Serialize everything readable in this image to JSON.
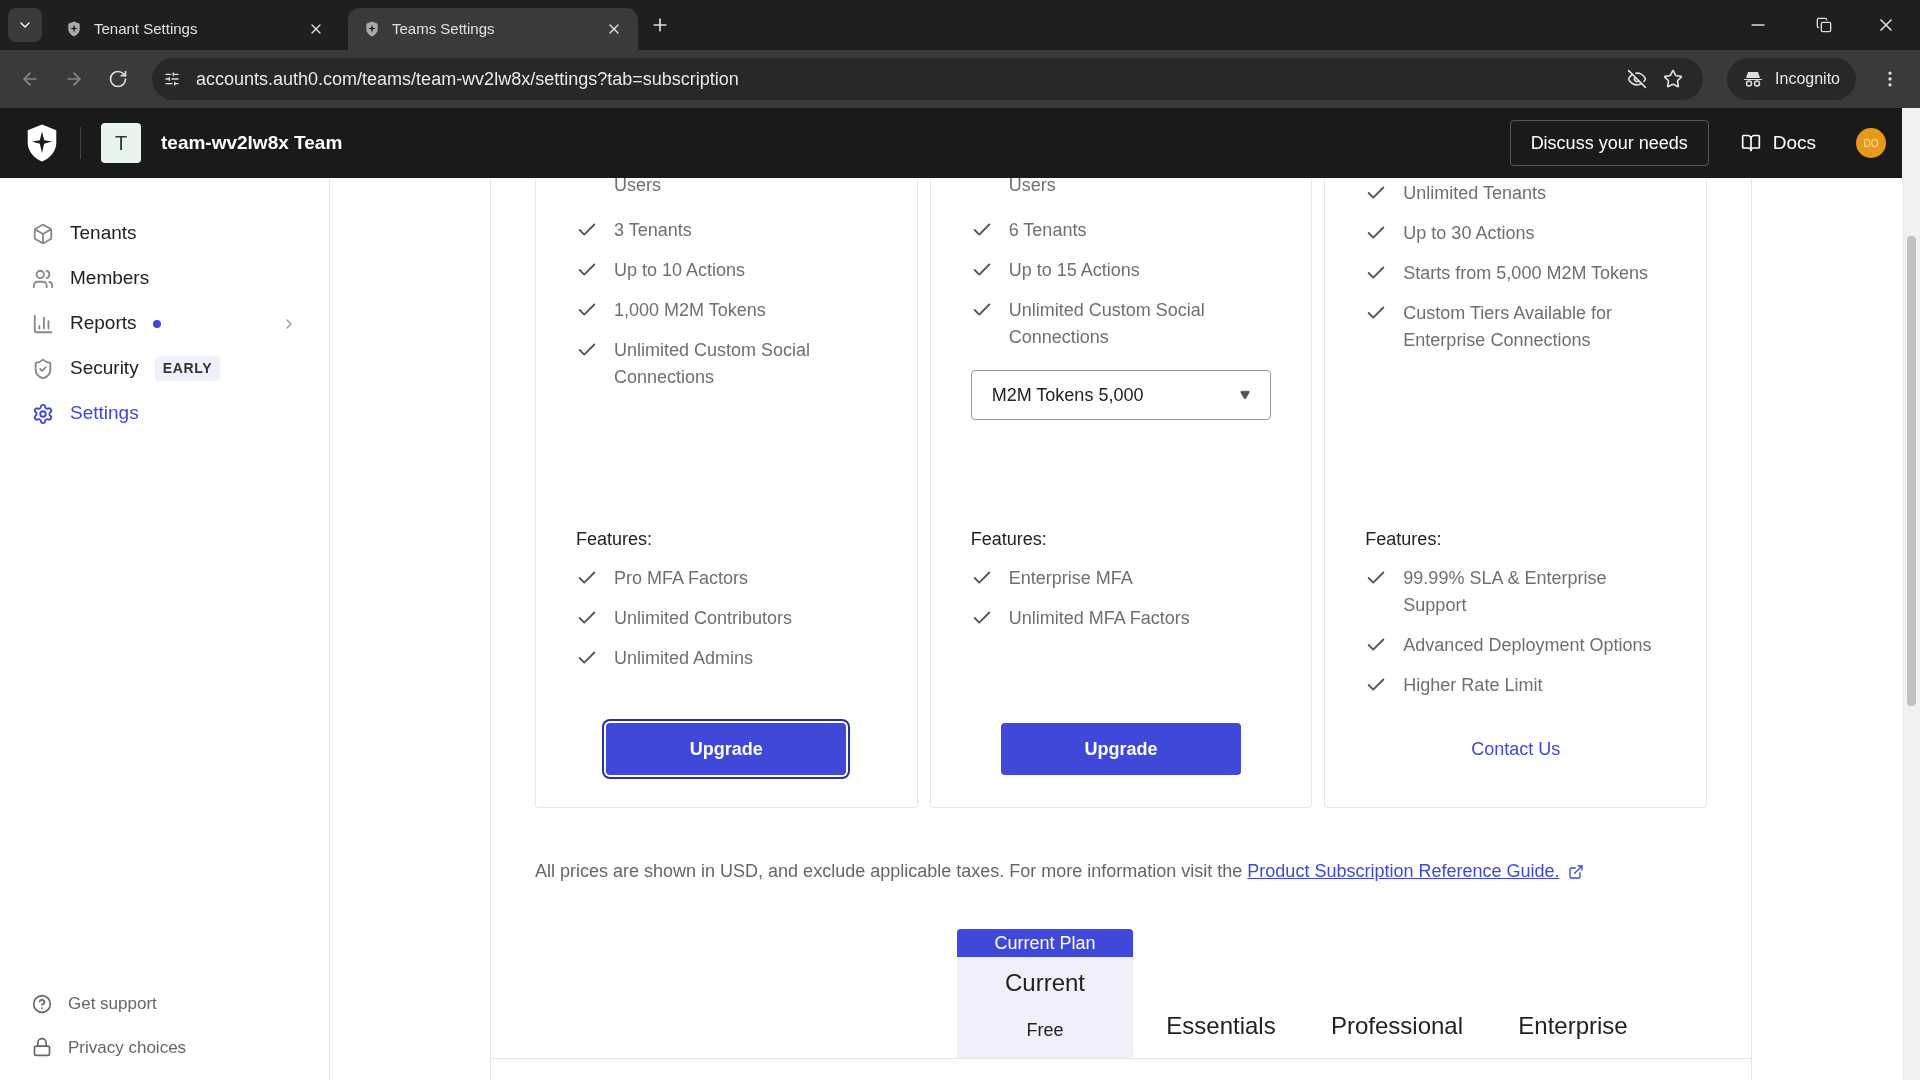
{
  "browser": {
    "tabs": [
      {
        "title": "Tenant Settings",
        "selected": false
      },
      {
        "title": "Teams Settings",
        "selected": true
      }
    ],
    "url": "accounts.auth0.com/teams/team-wv2lw8x/settings?tab=subscription",
    "profile": "Incognito"
  },
  "header": {
    "team_initial": "T",
    "team_name": "team-wv2lw8x Team",
    "discuss_button": "Discuss your needs",
    "docs": "Docs",
    "avatar": "DO"
  },
  "sidebar": {
    "items": [
      {
        "label": "Tenants",
        "selected": false
      },
      {
        "label": "Members",
        "selected": false
      },
      {
        "label": "Reports",
        "selected": false,
        "dot": true,
        "chevron": true
      },
      {
        "label": "Security",
        "selected": false,
        "badge": "EARLY"
      },
      {
        "label": "Settings",
        "selected": true
      }
    ],
    "footer": [
      {
        "label": "Get support"
      },
      {
        "label": "Privacy choices"
      }
    ]
  },
  "plans": [
    {
      "limits": [
        {
          "kind": "continuation",
          "text": "Users"
        },
        {
          "kind": "item",
          "text": "3 Tenants"
        },
        {
          "kind": "item",
          "text": "Up to 10 Actions"
        },
        {
          "kind": "item",
          "text": "1,000 M2M Tokens"
        },
        {
          "kind": "item",
          "text": "Unlimited Custom Social Connections"
        }
      ],
      "features_label": "Features:",
      "features": [
        "Pro MFA Factors",
        "Unlimited Contributors",
        "Unlimited Admins"
      ],
      "action": {
        "kind": "button",
        "label": "Upgrade",
        "focused": true
      }
    },
    {
      "limits": [
        {
          "kind": "continuation",
          "text": "Users"
        },
        {
          "kind": "item",
          "text": "6 Tenants"
        },
        {
          "kind": "item",
          "text": "Up to 15 Actions"
        },
        {
          "kind": "item",
          "text": "Unlimited Custom Social Connections"
        }
      ],
      "select": "M2M Tokens 5,000",
      "features_label": "Features:",
      "features": [
        "Enterprise MFA",
        "Unlimited MFA Factors"
      ],
      "action": {
        "kind": "button",
        "label": "Upgrade",
        "focused": false
      }
    },
    {
      "limits": [
        {
          "kind": "item",
          "text": "Unlimited Tenants"
        },
        {
          "kind": "item",
          "text": "Up to 30 Actions"
        },
        {
          "kind": "item",
          "text": "Starts from 5,000 M2M Tokens"
        },
        {
          "kind": "item",
          "text": "Custom Tiers Available for Enterprise Connections"
        }
      ],
      "features_label": "Features:",
      "features": [
        "99.99% SLA & Enterprise Support",
        "Advanced Deployment Options",
        "Higher Rate Limit"
      ],
      "action": {
        "kind": "link",
        "label": "Contact Us",
        "focused": false
      }
    }
  ],
  "note": {
    "text": "All prices are shown in USD, and exclude applicable taxes. For more information visit the",
    "link": "Product Subscription Reference Guide."
  },
  "comparison": {
    "columns": [
      {
        "badge": "Current Plan",
        "name": "Current",
        "price": "Free",
        "selected": true
      },
      {
        "name": "Essentials",
        "selected": false
      },
      {
        "name": "Professional",
        "selected": false
      },
      {
        "name": "Enterprise",
        "selected": false
      }
    ]
  }
}
